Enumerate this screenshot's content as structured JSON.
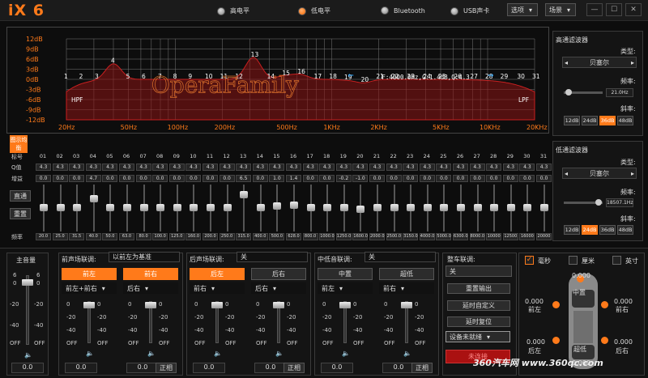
{
  "app": {
    "logo": "iX 6"
  },
  "modes": [
    {
      "label": "高电平",
      "on": false
    },
    {
      "label": "低电平",
      "on": true
    },
    {
      "label": "Bluetooth",
      "on": false
    },
    {
      "label": "USB声卡",
      "on": false
    }
  ],
  "menus": {
    "options": "选项",
    "scene": "场景"
  },
  "window": {
    "min": "—",
    "max": "☐",
    "close": "✕"
  },
  "graph": {
    "db_labels": [
      "12dB",
      "9dB",
      "6dB",
      "3dB",
      "0dB",
      "-3dB",
      "-6dB",
      "-9dB",
      "-12dB"
    ],
    "freq_labels": [
      "20Hz",
      "50Hz",
      "100Hz",
      "200Hz",
      "500Hz",
      "1KHz",
      "2KHz",
      "5KHz",
      "10KHz",
      "20KHz"
    ],
    "hpf": "HPF",
    "lpf": "LPF",
    "info": "F:4000.0Hz,G:1.4dB,Q:4.3",
    "watermark": "OperaFamily",
    "points": [
      "1",
      "2",
      "3",
      "4",
      "5",
      "6",
      "7",
      "8",
      "9",
      "10",
      "11",
      "12",
      "13",
      "14",
      "15",
      "16",
      "17",
      "18",
      "19",
      "20",
      "21",
      "22",
      "23",
      "24",
      "25",
      "26",
      "27",
      "28",
      "29",
      "30",
      "31"
    ]
  },
  "eq": {
    "side_label": "图示均衡",
    "row_labels": {
      "band": "标号",
      "q": "Q值",
      "gain": "增益",
      "freq": "频率"
    },
    "bands": [
      "01",
      "02",
      "03",
      "04",
      "05",
      "06",
      "07",
      "08",
      "09",
      "10",
      "11",
      "12",
      "13",
      "14",
      "15",
      "16",
      "17",
      "18",
      "19",
      "20",
      "21",
      "22",
      "23",
      "24",
      "25",
      "26",
      "27",
      "28",
      "29",
      "30",
      "31"
    ],
    "q": [
      "4.3",
      "4.3",
      "4.3",
      "4.3",
      "4.3",
      "4.3",
      "4.3",
      "4.3",
      "4.3",
      "4.3",
      "4.3",
      "4.3",
      "4.3",
      "4.3",
      "4.3",
      "4.3",
      "4.3",
      "4.3",
      "4.3",
      "4.3",
      "4.3",
      "4.3",
      "4.3",
      "4.3",
      "4.3",
      "4.3",
      "4.3",
      "4.3",
      "4.3",
      "4.3",
      "4.3"
    ],
    "gain": [
      "0.0",
      "0.0",
      "0.0",
      "4.7",
      "0.0",
      "0.0",
      "0.0",
      "0.0",
      "0.0",
      "0.0",
      "0.0",
      "0.0",
      "6.5",
      "0.0",
      "1.0",
      "1.4",
      "0.0",
      "0.0",
      "-0.2",
      "-1.0",
      "0.0",
      "0.0",
      "0.0",
      "0.0",
      "0.0",
      "0.0",
      "0.0",
      "0.0",
      "0.0",
      "0.0",
      "0.0"
    ],
    "freq": [
      "20.0",
      "25.0",
      "31.5",
      "40.0",
      "50.0",
      "63.0",
      "80.0",
      "100.0",
      "125.0",
      "160.0",
      "200.0",
      "250.0",
      "315.0",
      "400.0",
      "500.0",
      "628.0",
      "800.0",
      "1000.0",
      "1250.0",
      "1600.0",
      "2000.0",
      "2500.0",
      "3150.0",
      "4000.0",
      "5000.0",
      "6300.0",
      "8000.0",
      "10000",
      "12500",
      "16000",
      "20000"
    ],
    "bypass": "直通",
    "reset": "重置"
  },
  "hpf": {
    "title": "高通滤波器",
    "type_label": "类型:",
    "type": "贝塞尔",
    "freq_label": "频率:",
    "freq": "21.0Hz",
    "slope_label": "斜率:",
    "slopes": [
      "12dB",
      "24dB",
      "36dB",
      "48dB"
    ],
    "slope_on": 2
  },
  "lpf": {
    "title": "低通滤波器",
    "type_label": "类型:",
    "type": "贝塞尔",
    "freq_label": "频率:",
    "freq": "18507.1Hz",
    "slope_label": "斜率:",
    "slopes": [
      "12dB",
      "24dB",
      "36dB",
      "48dB"
    ],
    "slope_on": 1
  },
  "master": {
    "title": "主音量",
    "scale": [
      "6",
      "0",
      "-20",
      "-40",
      "OFF"
    ],
    "value": "0.0"
  },
  "front": {
    "title": "前声场联调:",
    "mode": "以前左为基准",
    "left": "前左",
    "right": "前右",
    "left_sel": "前左+前右",
    "right_sel": "后右",
    "scale": [
      "0",
      "-20",
      "-40",
      "OFF"
    ],
    "lval": "0.0",
    "rval": "0.0",
    "invert": "正相"
  },
  "rear": {
    "title": "后声场联调:",
    "mode": "关",
    "left": "后左",
    "right": "后右",
    "left_sel": "前右",
    "right_sel": "后右",
    "scale": [
      "0",
      "-20",
      "-40",
      "OFF"
    ],
    "lval": "0.0",
    "rval": "0.0",
    "invert": "正相"
  },
  "sub": {
    "title": "中低音联调:",
    "mode": "关",
    "left": "中置",
    "right": "超低",
    "left_sel": "前左",
    "right_sel": "前右",
    "scale": [
      "0",
      "-20",
      "-40",
      "OFF"
    ],
    "lval": "0.0",
    "rval": "0.0",
    "invert": "正相"
  },
  "car": {
    "title": "整车联调:",
    "mode": "关",
    "reset_out": "重置输出",
    "delay_custom": "延时自定义",
    "delay_reset": "延时复位",
    "device": "设备未就绪",
    "connect": "未连接"
  },
  "units": {
    "ms": "毫秒",
    "cm": "厘米",
    "inch": "英寸"
  },
  "speakers": {
    "center": "中置",
    "fl": "前左",
    "fr": "前右",
    "sub": "超低",
    "rl": "后左",
    "rr": "后右",
    "fl_v": "0.000",
    "fr_v": "0.000",
    "c_v": "0.000",
    "sub_v": "0.000",
    "rl_v": "0.000",
    "rr_v": "0.000"
  },
  "watermark": "360汽车网 www.360qc.com"
}
